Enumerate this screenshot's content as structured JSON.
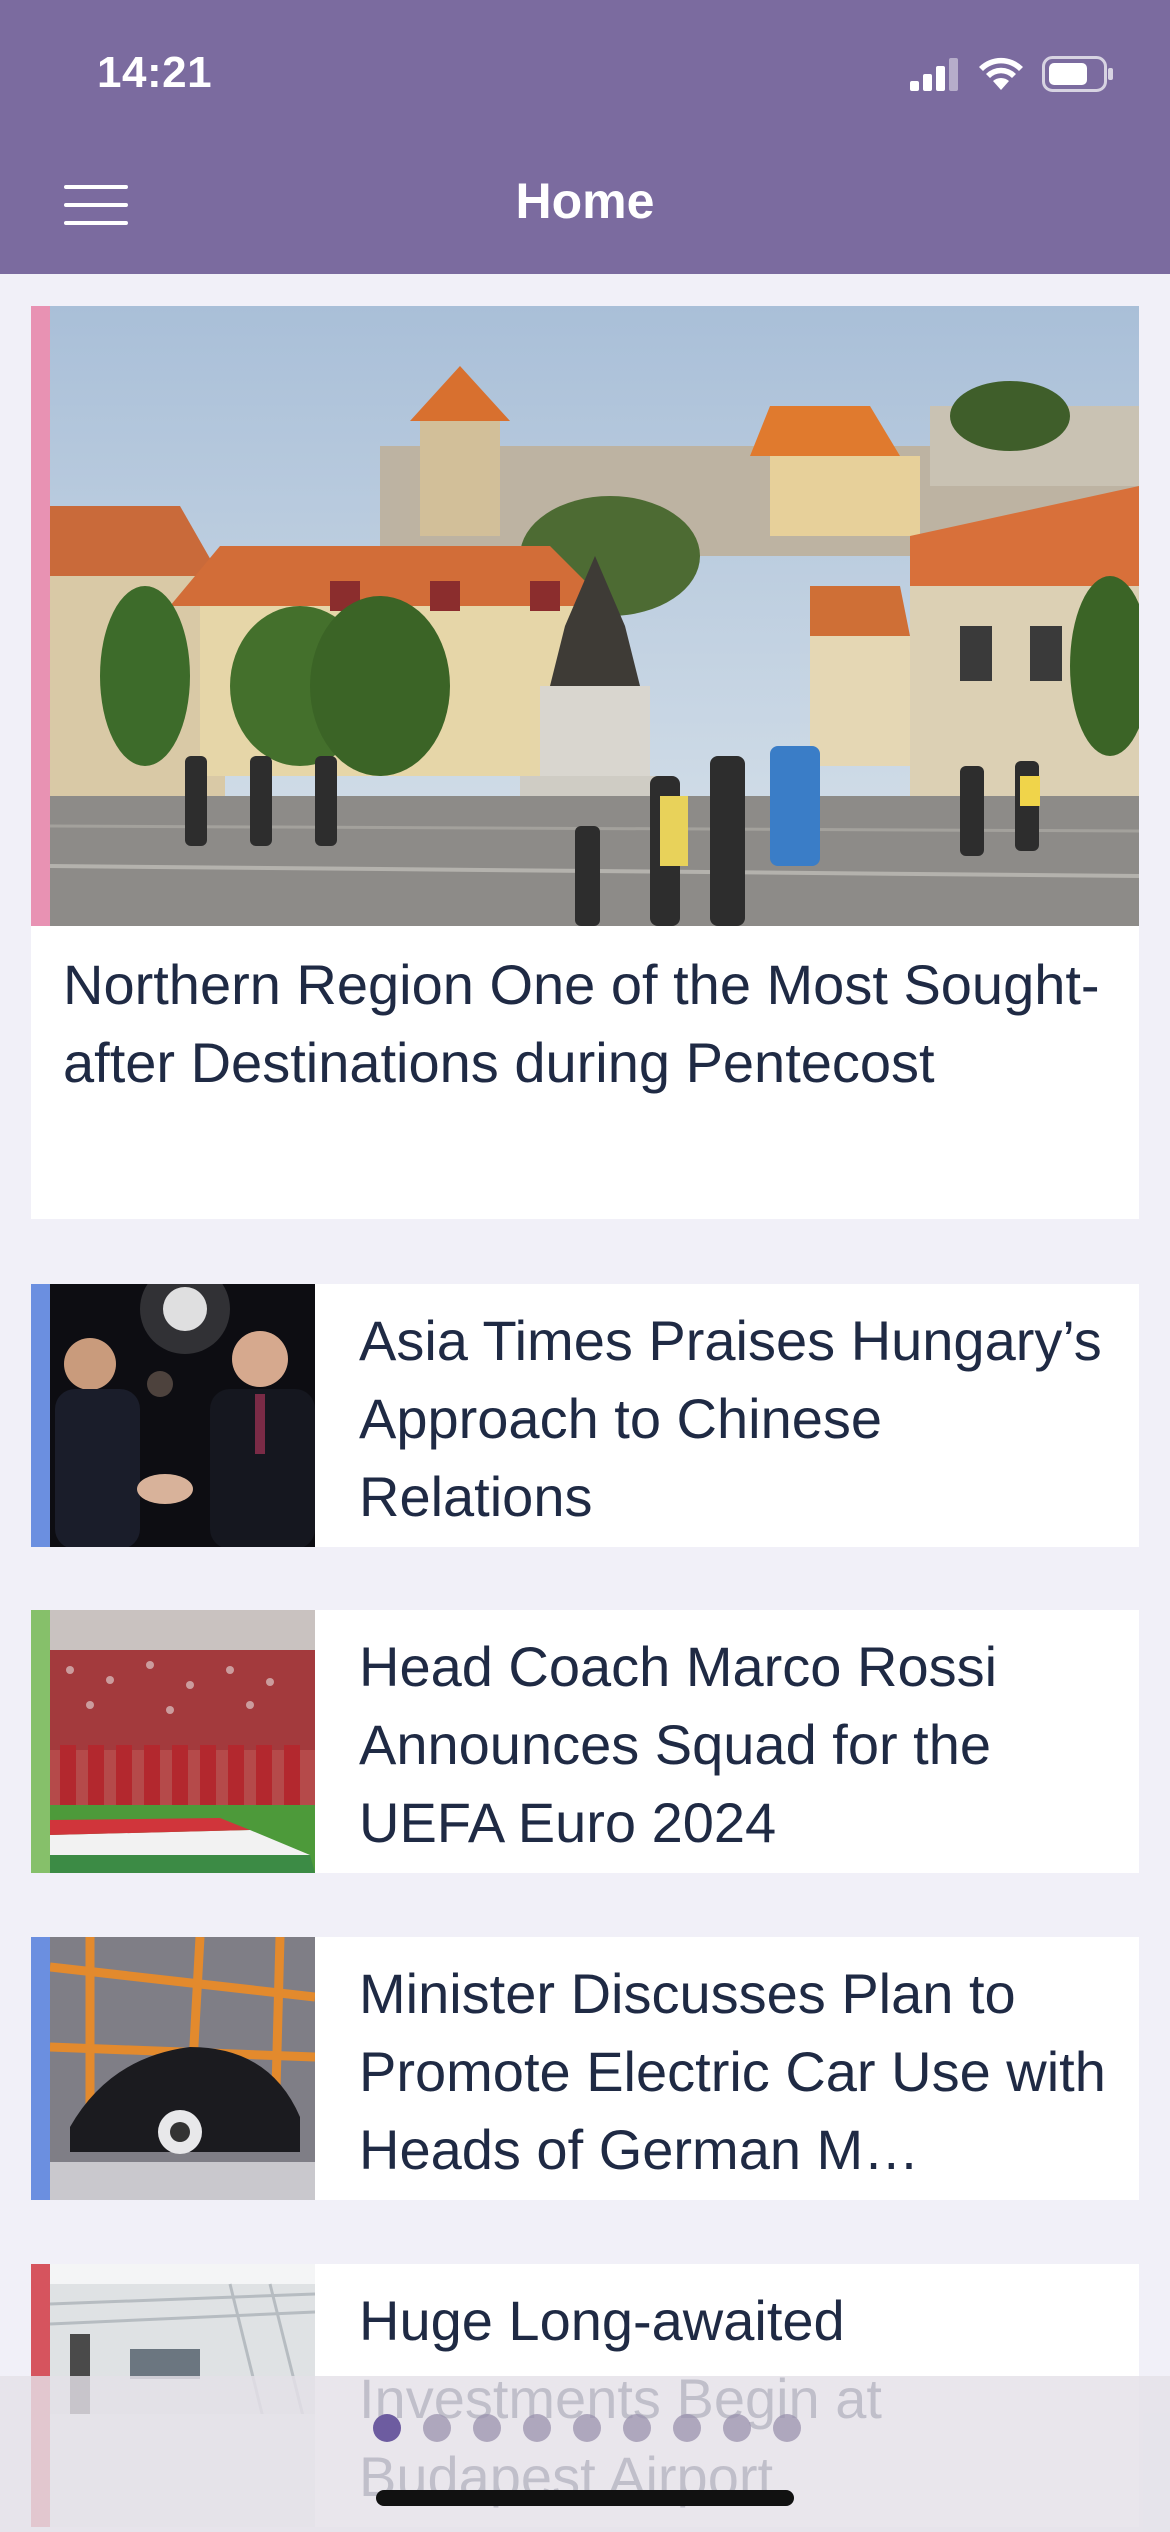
{
  "status_bar": {
    "time": "14:21"
  },
  "header": {
    "title": "Home"
  },
  "hero": {
    "title": "Northern Region One of the Most Sought-after Destinations during Pentecost",
    "accent_color": "#e892b3"
  },
  "articles": [
    {
      "title": "Asia Times Praises Hungary’s Approach to Chinese Relations",
      "accent_color": "#6b8fe0"
    },
    {
      "title": "Head Coach Marco Rossi Announces Squad for the UEFA Euro 2024",
      "accent_color": "#86c06a"
    },
    {
      "title": "Minister Discusses Plan to Promote Electric Car Use with Heads of German M…",
      "accent_color": "#6b8fe0"
    },
    {
      "title": "Huge Long-awaited Investments Begin at Budapest Airport",
      "accent_color": "#d6545e"
    }
  ],
  "pager": {
    "count": 9,
    "active": 1
  },
  "colors": {
    "header": "#7b6b9f",
    "background": "#f1f0f8",
    "title_text": "#1f2a44"
  }
}
